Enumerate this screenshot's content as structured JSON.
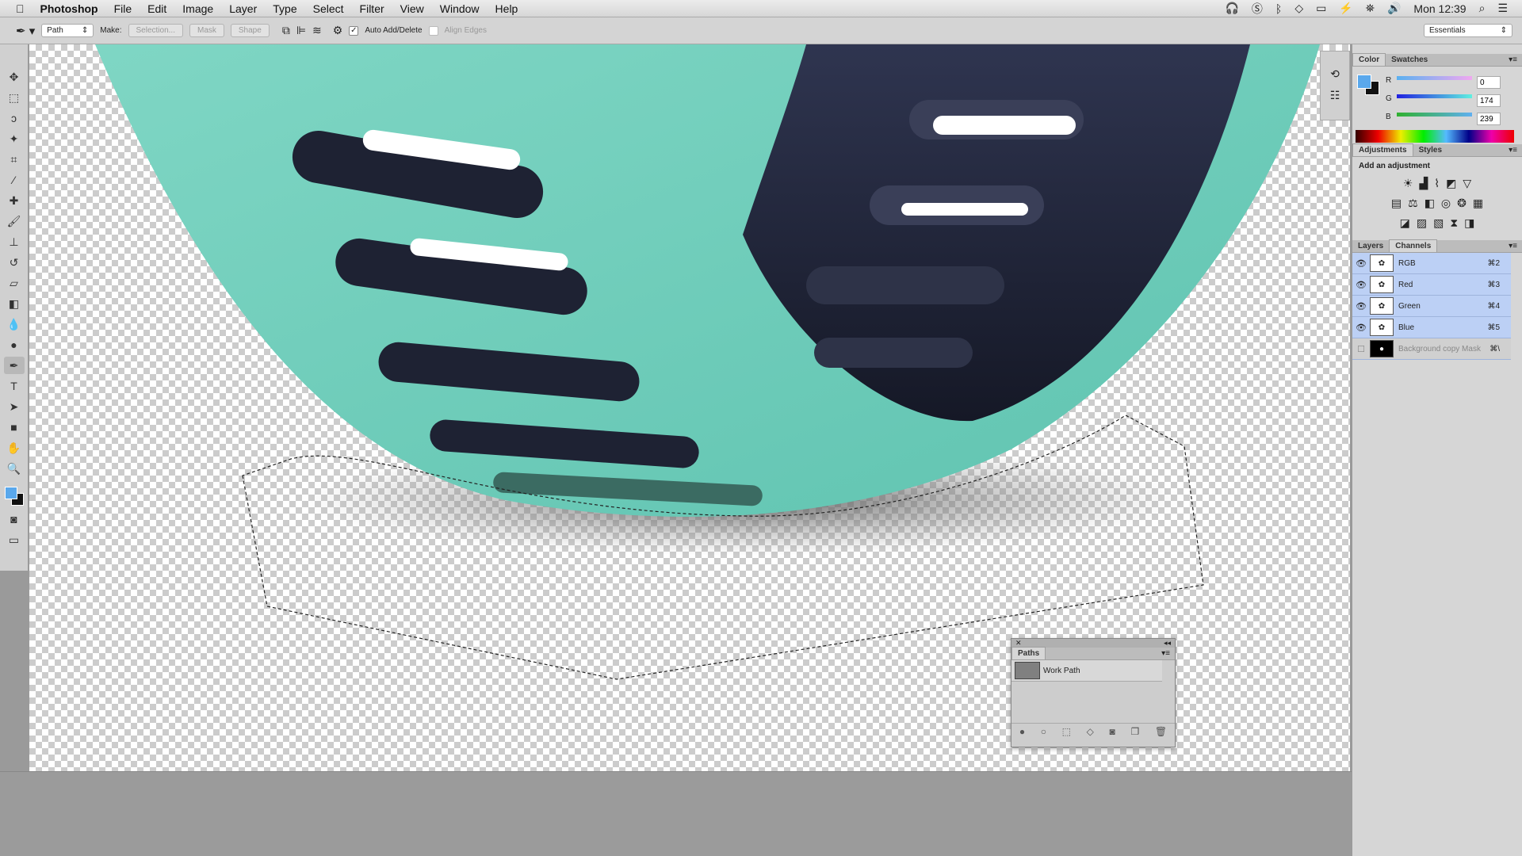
{
  "menubar": {
    "apple": "",
    "app": "Photoshop",
    "items": [
      "File",
      "Edit",
      "Image",
      "Layer",
      "Type",
      "Select",
      "Filter",
      "View",
      "Window",
      "Help"
    ],
    "clock": "Mon 12:39"
  },
  "options": {
    "mode": "Path",
    "make_label": "Make:",
    "selection": "Selection...",
    "mask": "Mask",
    "shape": "Shape",
    "auto_add_delete": "Auto Add/Delete",
    "auto_add_checked": true,
    "align_edges": "Align Edges",
    "align_checked": false,
    "workspace": "Essentials"
  },
  "tools": [
    "move",
    "marquee",
    "lasso",
    "quick-select",
    "crop",
    "eyedropper",
    "healing",
    "brush",
    "stamp",
    "history-brush",
    "eraser",
    "gradient",
    "blur",
    "dodge",
    "pen",
    "type",
    "path-select",
    "rectangle",
    "hand",
    "zoom"
  ],
  "color_panel": {
    "tabs": [
      "Color",
      "Swatches"
    ],
    "r_label": "R",
    "g_label": "G",
    "b_label": "B",
    "r": "0",
    "g": "174",
    "b": "239",
    "foreground": "#5aa8ec",
    "background": "#111111"
  },
  "adjust_panel": {
    "tabs": [
      "Adjustments",
      "Styles"
    ],
    "heading": "Add an adjustment"
  },
  "layers_panel": {
    "tabs": [
      "Layers",
      "Channels"
    ],
    "channels": [
      {
        "name": "RGB",
        "shortcut": "⌘2",
        "visible": true
      },
      {
        "name": "Red",
        "shortcut": "⌘3",
        "visible": true
      },
      {
        "name": "Green",
        "shortcut": "⌘4",
        "visible": true
      },
      {
        "name": "Blue",
        "shortcut": "⌘5",
        "visible": true
      },
      {
        "name": "Background copy Mask",
        "shortcut": "⌘\\",
        "visible": false
      }
    ]
  },
  "paths_panel": {
    "tab": "Paths",
    "items": [
      "Work Path"
    ]
  },
  "colors": {
    "teal": "#7fd6c4",
    "dark": "#262a3f",
    "selection": "#bcd0f5"
  }
}
